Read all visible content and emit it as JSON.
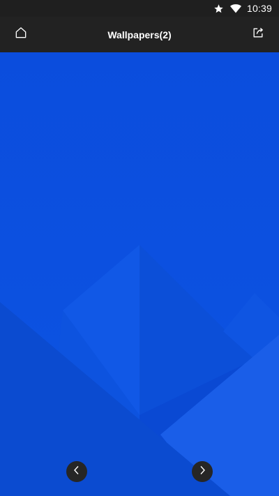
{
  "status_bar": {
    "time": "10:39",
    "icons": [
      "star-icon",
      "wifi-icon"
    ]
  },
  "app_bar": {
    "title": "Wallpapers(2)",
    "left_icon": "home-icon",
    "right_icon": "share-icon"
  },
  "wallpaper": {
    "base_color": "#0c4fde"
  },
  "navigation": {
    "prev_icon": "chevron-left-icon",
    "next_icon": "chevron-right-icon"
  }
}
